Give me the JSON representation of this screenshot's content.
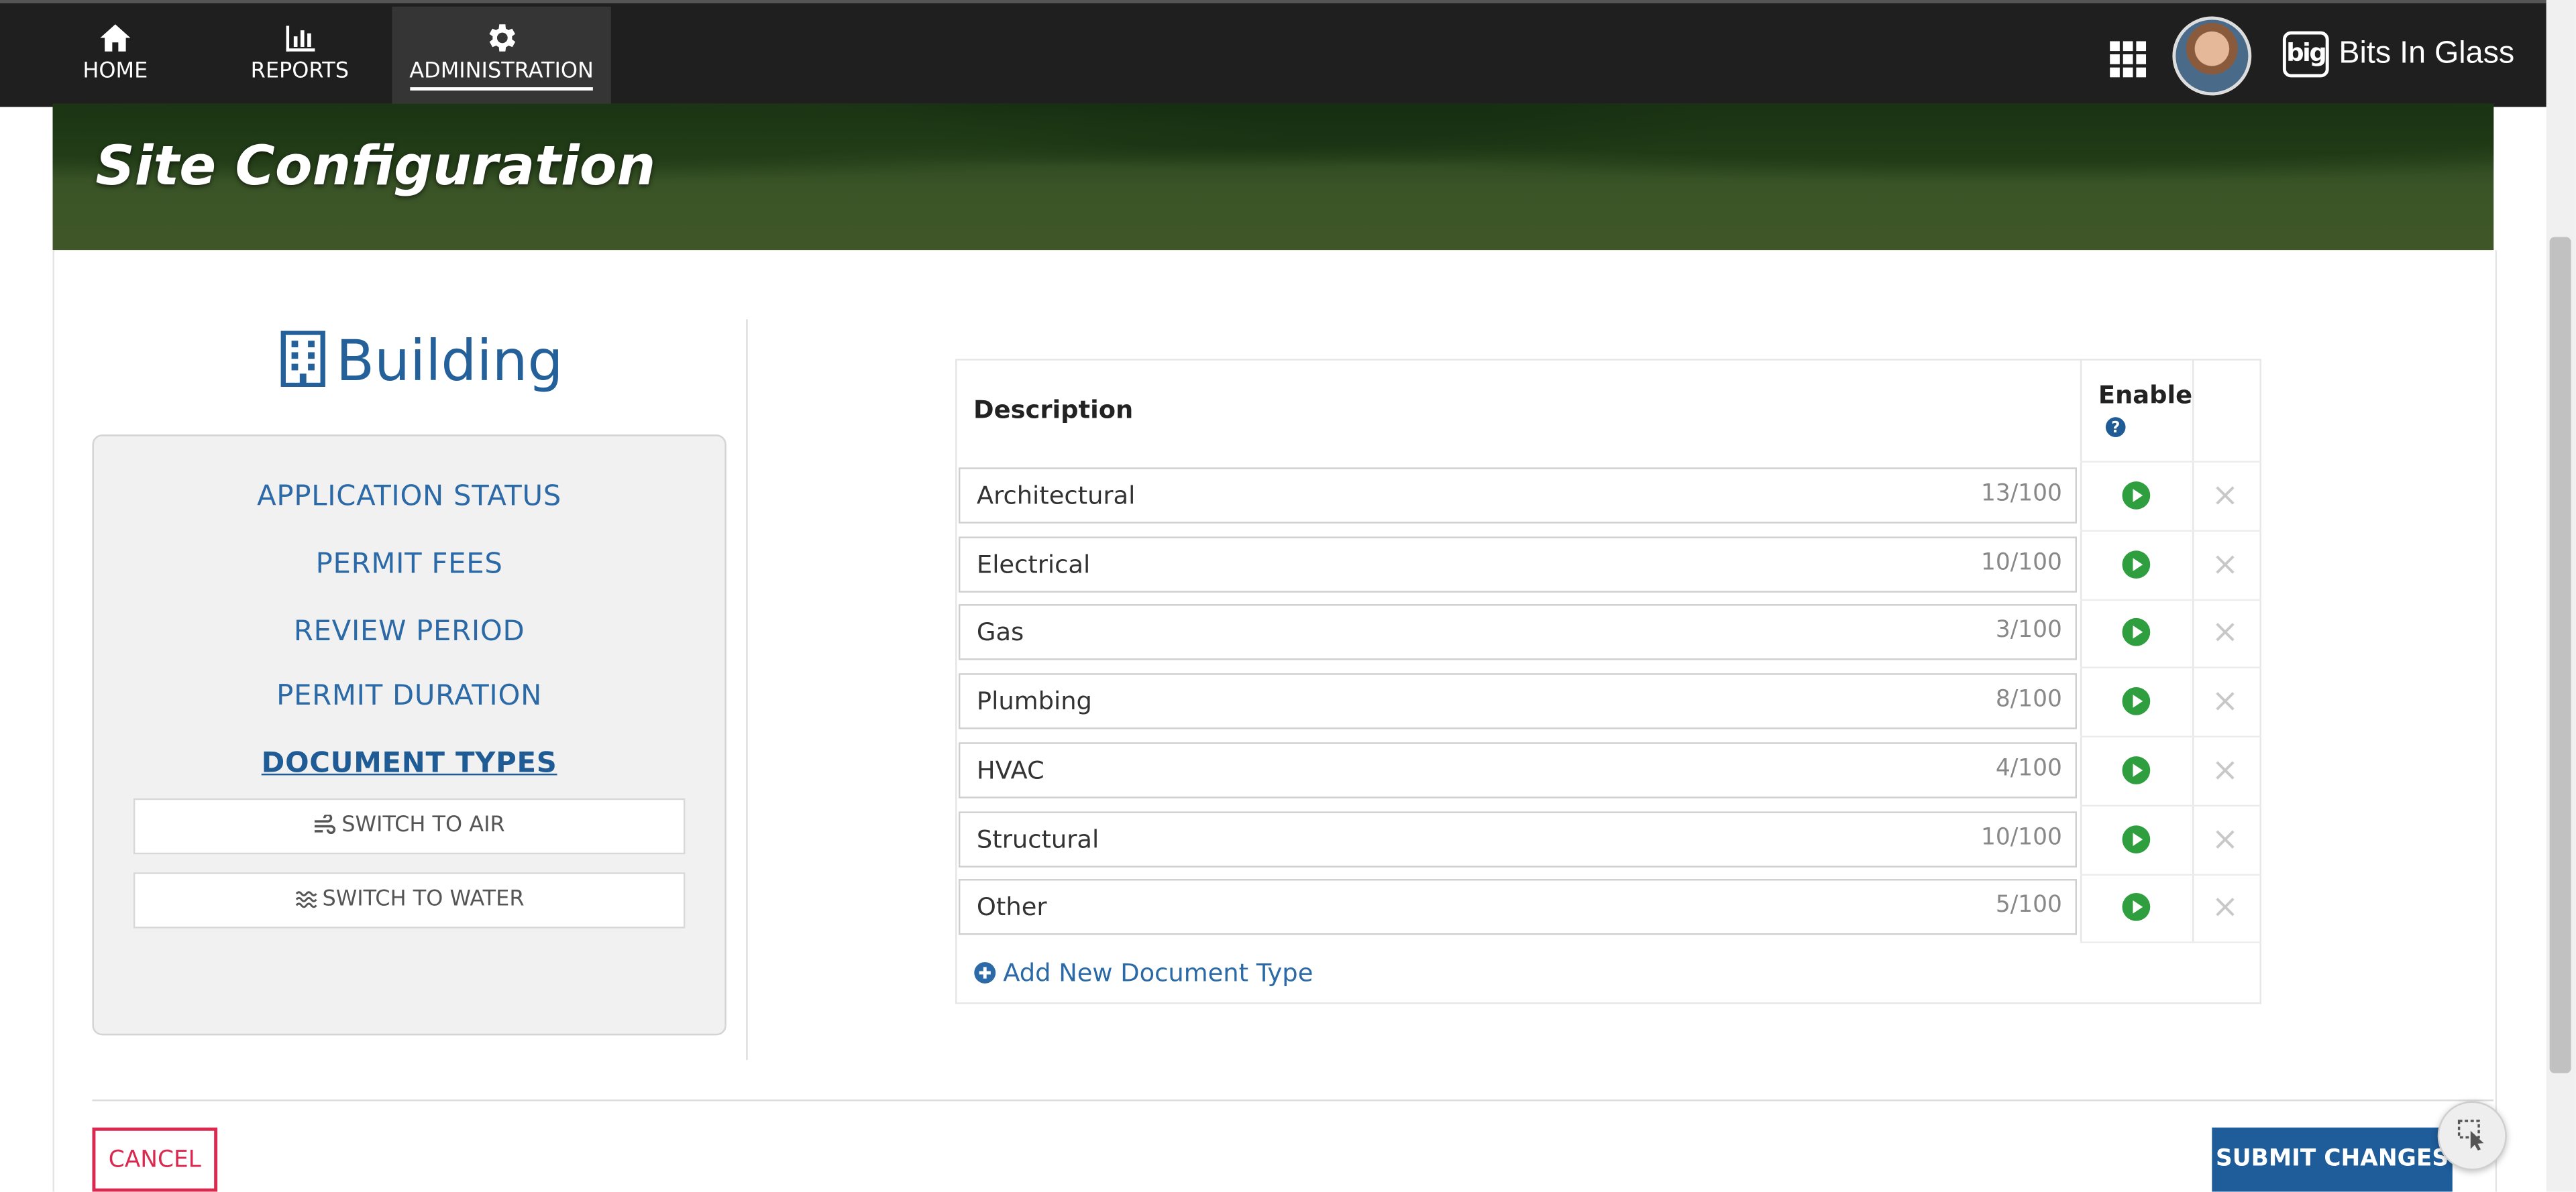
{
  "nav": {
    "items": [
      {
        "label": "HOME",
        "icon": "home-icon"
      },
      {
        "label": "REPORTS",
        "icon": "bar-chart-icon"
      },
      {
        "label": "ADMINISTRATION",
        "icon": "gear-icon",
        "active": true
      }
    ],
    "brand": {
      "logo_text": "big",
      "name": "Bits In Glass"
    }
  },
  "hero": {
    "title": "Site Configuration"
  },
  "sidebar": {
    "heading": "Building",
    "links": [
      {
        "label": "APPLICATION STATUS"
      },
      {
        "label": "PERMIT FEES"
      },
      {
        "label": "REVIEW PERIOD"
      },
      {
        "label": "PERMIT DURATION"
      },
      {
        "label": "DOCUMENT TYPES",
        "active": true
      }
    ],
    "switch_air": "SWITCH TO AIR",
    "switch_water": "SWITCH TO WATER"
  },
  "table": {
    "col_description": "Description",
    "col_enable": "Enable",
    "rows": [
      {
        "description": "Architectural",
        "count": "13/100"
      },
      {
        "description": "Electrical",
        "count": "10/100"
      },
      {
        "description": "Gas",
        "count": "3/100"
      },
      {
        "description": "Plumbing",
        "count": "8/100"
      },
      {
        "description": "HVAC",
        "count": "4/100"
      },
      {
        "description": "Structural",
        "count": "10/100"
      },
      {
        "description": "Other",
        "count": "5/100"
      }
    ],
    "add_label": "Add New Document Type"
  },
  "footer": {
    "cancel": "CANCEL",
    "submit": "SUBMIT CHANGES"
  },
  "colors": {
    "accent": "#24619b",
    "primary_button": "#1e5c9a",
    "cancel": "#d9294f",
    "enabled": "#2e9e3e",
    "topbar": "#1f1f1f"
  }
}
